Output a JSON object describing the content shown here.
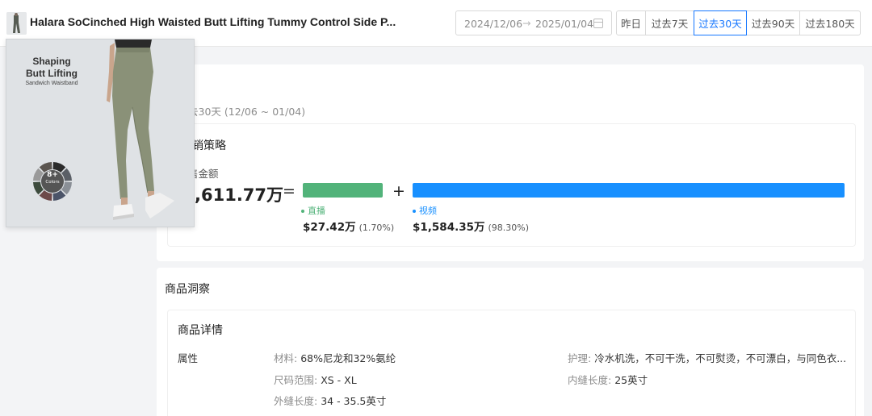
{
  "product": {
    "title": "Halara SoCinched High Waisted Butt Lifting Tummy Control Side P..."
  },
  "date_range": {
    "start": "2024/12/06",
    "separator": "→",
    "end": "2025/01/04"
  },
  "range_buttons": [
    {
      "label": "昨日",
      "active": false
    },
    {
      "label": "过去7天",
      "active": false
    },
    {
      "label": "过去30天",
      "active": true
    },
    {
      "label": "过去90天",
      "active": false
    },
    {
      "label": "过去180天",
      "active": false
    }
  ],
  "sales": {
    "period": "去30天 (12/06 ~ 01/04)",
    "section_title": "销策略",
    "amount_label": "售金额",
    "total": ",611.77万",
    "equals": "=",
    "plus": "+",
    "channels": [
      {
        "name": "直播",
        "value": "$27.42万",
        "percent": "(1.70%)",
        "share": 1.7,
        "color": "#52b37a"
      },
      {
        "name": "视频",
        "value": "$1,584.35万",
        "percent": "(98.30%)",
        "share": 98.3,
        "color": "#1890ff"
      }
    ]
  },
  "insight": {
    "title": "商品洞察",
    "detail_title": "商品详情",
    "attr_label": "属性",
    "attributes": {
      "material": {
        "key": "材料: ",
        "value": "68%尼龙和32%氨纶"
      },
      "size_range": {
        "key": "尺码范围: ",
        "value": "XS - XL"
      },
      "outseam": {
        "key": "外缝长度: ",
        "value": "34 - 35.5英寸"
      },
      "care": {
        "key": "护理: ",
        "value": "冷水机洗，不可干洗，不可熨烫，不可漂白，与同色衣..."
      },
      "inseam": {
        "key": "内缝长度: ",
        "value": "25英寸"
      }
    }
  },
  "product_image": {
    "line1": "Shaping",
    "line2": "Butt Lifting",
    "sub": "Sandwich Waistband",
    "colors_num": "8+",
    "colors_label": "Colors",
    "color_swatches": [
      "#2b2b2b",
      "#5a5f66",
      "#8a8f96",
      "#4b5468",
      "#6e4a4a",
      "#3d4b3d",
      "#9a9a9a",
      "#5b5550"
    ]
  },
  "colors": {
    "accent": "#1677ff",
    "live": "#52b37a",
    "video": "#1890ff",
    "pants": "#8a9178"
  }
}
